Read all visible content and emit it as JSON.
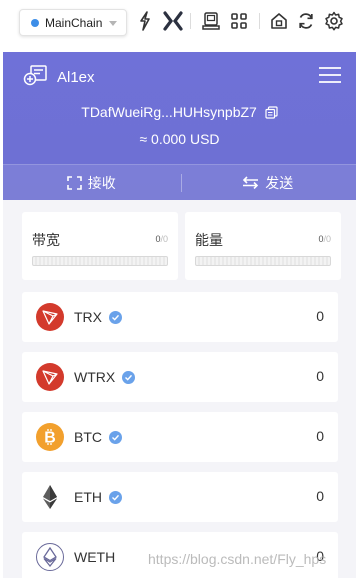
{
  "toolbar": {
    "network": "MainChain",
    "icons": [
      "bolt-icon",
      "x-logo-icon",
      "ledger-icon",
      "grid-icon",
      "lock-icon",
      "refresh-icon",
      "settings-icon"
    ]
  },
  "header": {
    "wallet_name": "Al1ex",
    "address": "TDafWueiRg...HUHsynpbZ7",
    "balance": "≈ 0.000 USD",
    "receive_label": "接收",
    "send_label": "发送"
  },
  "resources": [
    {
      "label": "带宽",
      "used": "0",
      "total": "0"
    },
    {
      "label": "能量",
      "used": "0",
      "total": "0"
    }
  ],
  "tokens": [
    {
      "symbol": "TRX",
      "balance": "0",
      "color": "#d33a2c"
    },
    {
      "symbol": "WTRX",
      "balance": "0",
      "color": "#d33a2c"
    },
    {
      "symbol": "BTC",
      "balance": "0",
      "color": "#f2a02d"
    },
    {
      "symbol": "ETH",
      "balance": "0",
      "color": "#5d5d5d"
    },
    {
      "symbol": "WETH",
      "balance": "0",
      "color": "#6a6a9a"
    }
  ],
  "watermark": "https://blog.csdn.net/Fly_hps",
  "colors": {
    "header": "#6f71d8",
    "verify": "#6aa2ea",
    "network_dot": "#3d8ee8"
  }
}
